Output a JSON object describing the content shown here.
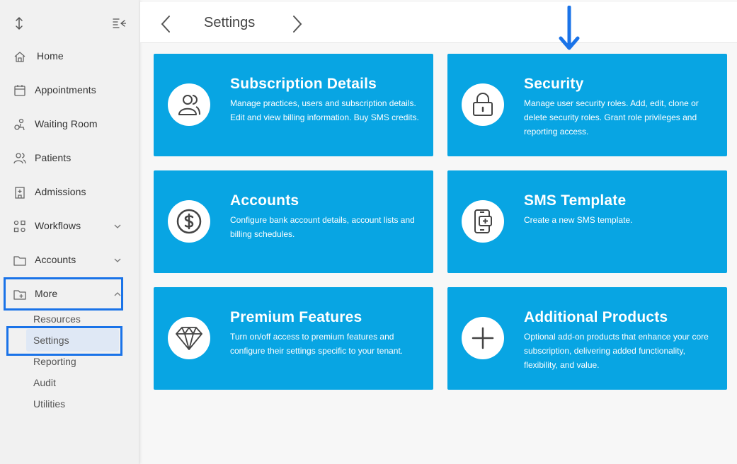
{
  "sidebar": {
    "expand_icon": "vertical-arrows-icon",
    "collapse_icon": "collapse-menu-icon",
    "items": [
      {
        "label": "Home",
        "icon": "home-icon"
      },
      {
        "label": "Appointments",
        "icon": "calendar-icon"
      },
      {
        "label": "Waiting Room",
        "icon": "waiting-room-icon"
      },
      {
        "label": "Patients",
        "icon": "patients-icon"
      },
      {
        "label": "Admissions",
        "icon": "hospital-icon"
      },
      {
        "label": "Workflows",
        "icon": "workflows-icon",
        "expandable": true
      },
      {
        "label": "Accounts",
        "icon": "folder-icon",
        "expandable": true
      },
      {
        "label": "More",
        "icon": "folder-plus-icon",
        "expanded": true
      }
    ],
    "sub_items": [
      {
        "label": "Resources"
      },
      {
        "label": "Settings",
        "active": true
      },
      {
        "label": "Reporting"
      },
      {
        "label": "Audit"
      },
      {
        "label": "Utilities"
      }
    ]
  },
  "header": {
    "title": "Settings",
    "back_icon": "chevron-left-icon",
    "forward_icon": "chevron-right-icon"
  },
  "cards": [
    {
      "title": "Subscription Details",
      "description": "Manage practices, users and subscription details. Edit and view billing information. Buy SMS credits.",
      "icon": "users-icon"
    },
    {
      "title": "Security",
      "description": "Manage user security roles. Add, edit, clone or delete security roles. Grant role privileges and reporting access.",
      "icon": "lock-icon"
    },
    {
      "title": "Accounts",
      "description": "Configure bank account details, account lists and billing schedules.",
      "icon": "dollar-icon"
    },
    {
      "title": "SMS Template",
      "description": "Create a new SMS template.",
      "icon": "mobile-sms-icon"
    },
    {
      "title": "Premium Features",
      "description": "Turn on/off access to premium features and configure their settings specific to your tenant.",
      "icon": "diamond-icon"
    },
    {
      "title": "Additional Products",
      "description": "Optional add-on products that enhance your core subscription, delivering added functionality, flexibility, and value.",
      "icon": "plus-icon"
    }
  ],
  "colors": {
    "card_bg": "#08a5e3",
    "highlight": "#1a73e8",
    "sidebar_bg": "#f1f1f1",
    "active_item_bg": "#dfe8f5"
  }
}
